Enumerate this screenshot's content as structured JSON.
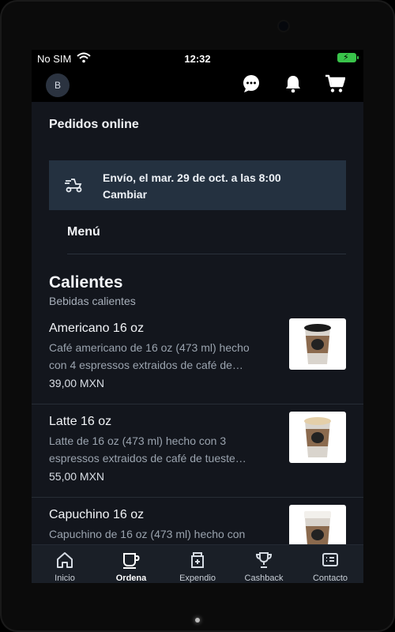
{
  "status": {
    "carrier": "No SIM",
    "time": "12:32"
  },
  "appbar": {
    "avatar_initial": "B",
    "icons": [
      "chat-icon",
      "bell-icon",
      "cart-icon"
    ]
  },
  "page": {
    "title": "Pedidos online",
    "delivery_line1": "Envío, el mar. 29 de oct. a las 8:00",
    "delivery_line2": "Cambiar",
    "menu_tab": "Menú"
  },
  "section": {
    "title": "Calientes",
    "subtitle": "Bebidas calientes"
  },
  "items": [
    {
      "name": "Americano 16 oz",
      "desc1": "Café americano de 16 oz (473 ml) hecho",
      "desc2": "con 4  espressos extraidos de café de…",
      "price": "39,00 MXN"
    },
    {
      "name": "Latte 16 oz",
      "desc1": "Latte de 16 oz (473 ml) hecho con 3",
      "desc2": "espressos extraidos de café de tueste…",
      "price": "55,00 MXN"
    },
    {
      "name": "Capuchino 16 oz",
      "desc1": "Capuchino de 16 oz (473 ml) hecho con",
      "desc2": "",
      "price": ""
    }
  ],
  "nav": [
    {
      "label": "Inicio",
      "icon": "home-icon"
    },
    {
      "label": "Ordena",
      "icon": "coffee-cup-icon",
      "active": true
    },
    {
      "label": "Expendio",
      "icon": "store-bag-icon"
    },
    {
      "label": "Cashback",
      "icon": "trophy-icon"
    },
    {
      "label": "Contacto",
      "icon": "contact-card-icon"
    }
  ],
  "colors": {
    "background": "#13161d",
    "delivery_bg": "#243140",
    "battery": "#39c34a"
  }
}
